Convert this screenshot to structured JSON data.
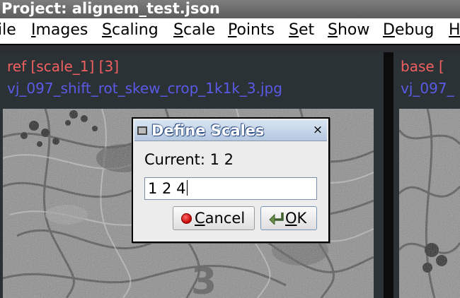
{
  "window": {
    "title": "Project: alignem_test.json"
  },
  "menubar": {
    "items": [
      {
        "label": "File",
        "shown": "ile",
        "mnemonic": "",
        "rest": "ile"
      },
      {
        "label": "Images",
        "mnemonic": "I",
        "rest": "mages"
      },
      {
        "label": "Scaling",
        "mnemonic": "S",
        "rest": "caling"
      },
      {
        "label": "Scale",
        "mnemonic": "S",
        "rest": "cale"
      },
      {
        "label": "Points",
        "mnemonic": "P",
        "rest": "oints"
      },
      {
        "label": "Set",
        "mnemonic": "S",
        "rest": "et"
      },
      {
        "label": "Show",
        "mnemonic": "S",
        "rest": "how"
      },
      {
        "label": "Debug",
        "mnemonic": "D",
        "rest": "ebug"
      },
      {
        "label": "H",
        "mnemonic": "H",
        "rest": ""
      }
    ]
  },
  "panels": {
    "left": {
      "role_label": "ref [scale_1] [3]",
      "filename": "vj_097_shift_rot_skew_crop_1k1k_3.jpg",
      "overlay_number": "3"
    },
    "right": {
      "role_label": "base [",
      "filename": "vj_097_"
    }
  },
  "dialog": {
    "title": "Define Scales",
    "close_glyph": "×",
    "current_label": "Current: 1 2",
    "input_value": "1 2 4",
    "cancel": {
      "mnemonic": "C",
      "rest": "ancel"
    },
    "ok": {
      "mnemonic": "O",
      "rest": "K"
    }
  },
  "colors": {
    "ref_label": "#f06060",
    "file_label": "#5a5ae6",
    "panel_bg": "#2b3236"
  },
  "icons": [
    "window-icon",
    "close-icon",
    "stop-icon",
    "checkmark-arrow-icon"
  ]
}
